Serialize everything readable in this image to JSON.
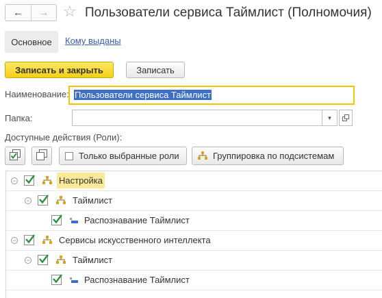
{
  "window": {
    "back_icon": "arrow-left-icon",
    "forward_icon": "arrow-right-icon",
    "favorite_icon": "star-icon",
    "title": "Пользователи сервиса Таймлист (Полномочия)"
  },
  "tabs": {
    "main": "Основное",
    "issued_to": "Кому выданы"
  },
  "toolbar": {
    "save_close": "Записать и закрыть",
    "save": "Записать"
  },
  "form": {
    "name_label": "Наименование:",
    "name_value": "Пользователи сервиса Таймлист",
    "folder_label": "Папка:",
    "folder_value": "",
    "roles_label": "Доступные действия (Роли):"
  },
  "roles_toolbar": {
    "check_all_icon": "check-all-icon",
    "uncheck_all_icon": "copy-icon",
    "only_selected": "Только выбранные роли",
    "group_by_subsystems": "Группировка по подсистемам"
  },
  "tree": [
    {
      "label": "Настройка",
      "level": 0,
      "checked": true,
      "bold": false,
      "highlighted": true,
      "type": "subsystem"
    },
    {
      "label": "Таймлист",
      "level": 1,
      "checked": true,
      "bold": true,
      "type": "subsystem"
    },
    {
      "label": "Распознавание Таймлист",
      "level": 2,
      "checked": true,
      "type": "role"
    },
    {
      "label": "Сервисы искусственного интеллекта",
      "level": 0,
      "checked": true,
      "type": "subsystem"
    },
    {
      "label": "Таймлист",
      "level": 1,
      "checked": true,
      "bold": true,
      "type": "subsystem"
    },
    {
      "label": "Распознавание Таймлист",
      "level": 2,
      "checked": true,
      "type": "role"
    }
  ],
  "colors": {
    "primary_button": "#f5cf12",
    "focus_border": "#f0c400",
    "selection": "#3d6fc7",
    "checkmark": "#2e8f3e",
    "hierarchy_icon": "#d9a320",
    "link": "#3a5ea7"
  }
}
